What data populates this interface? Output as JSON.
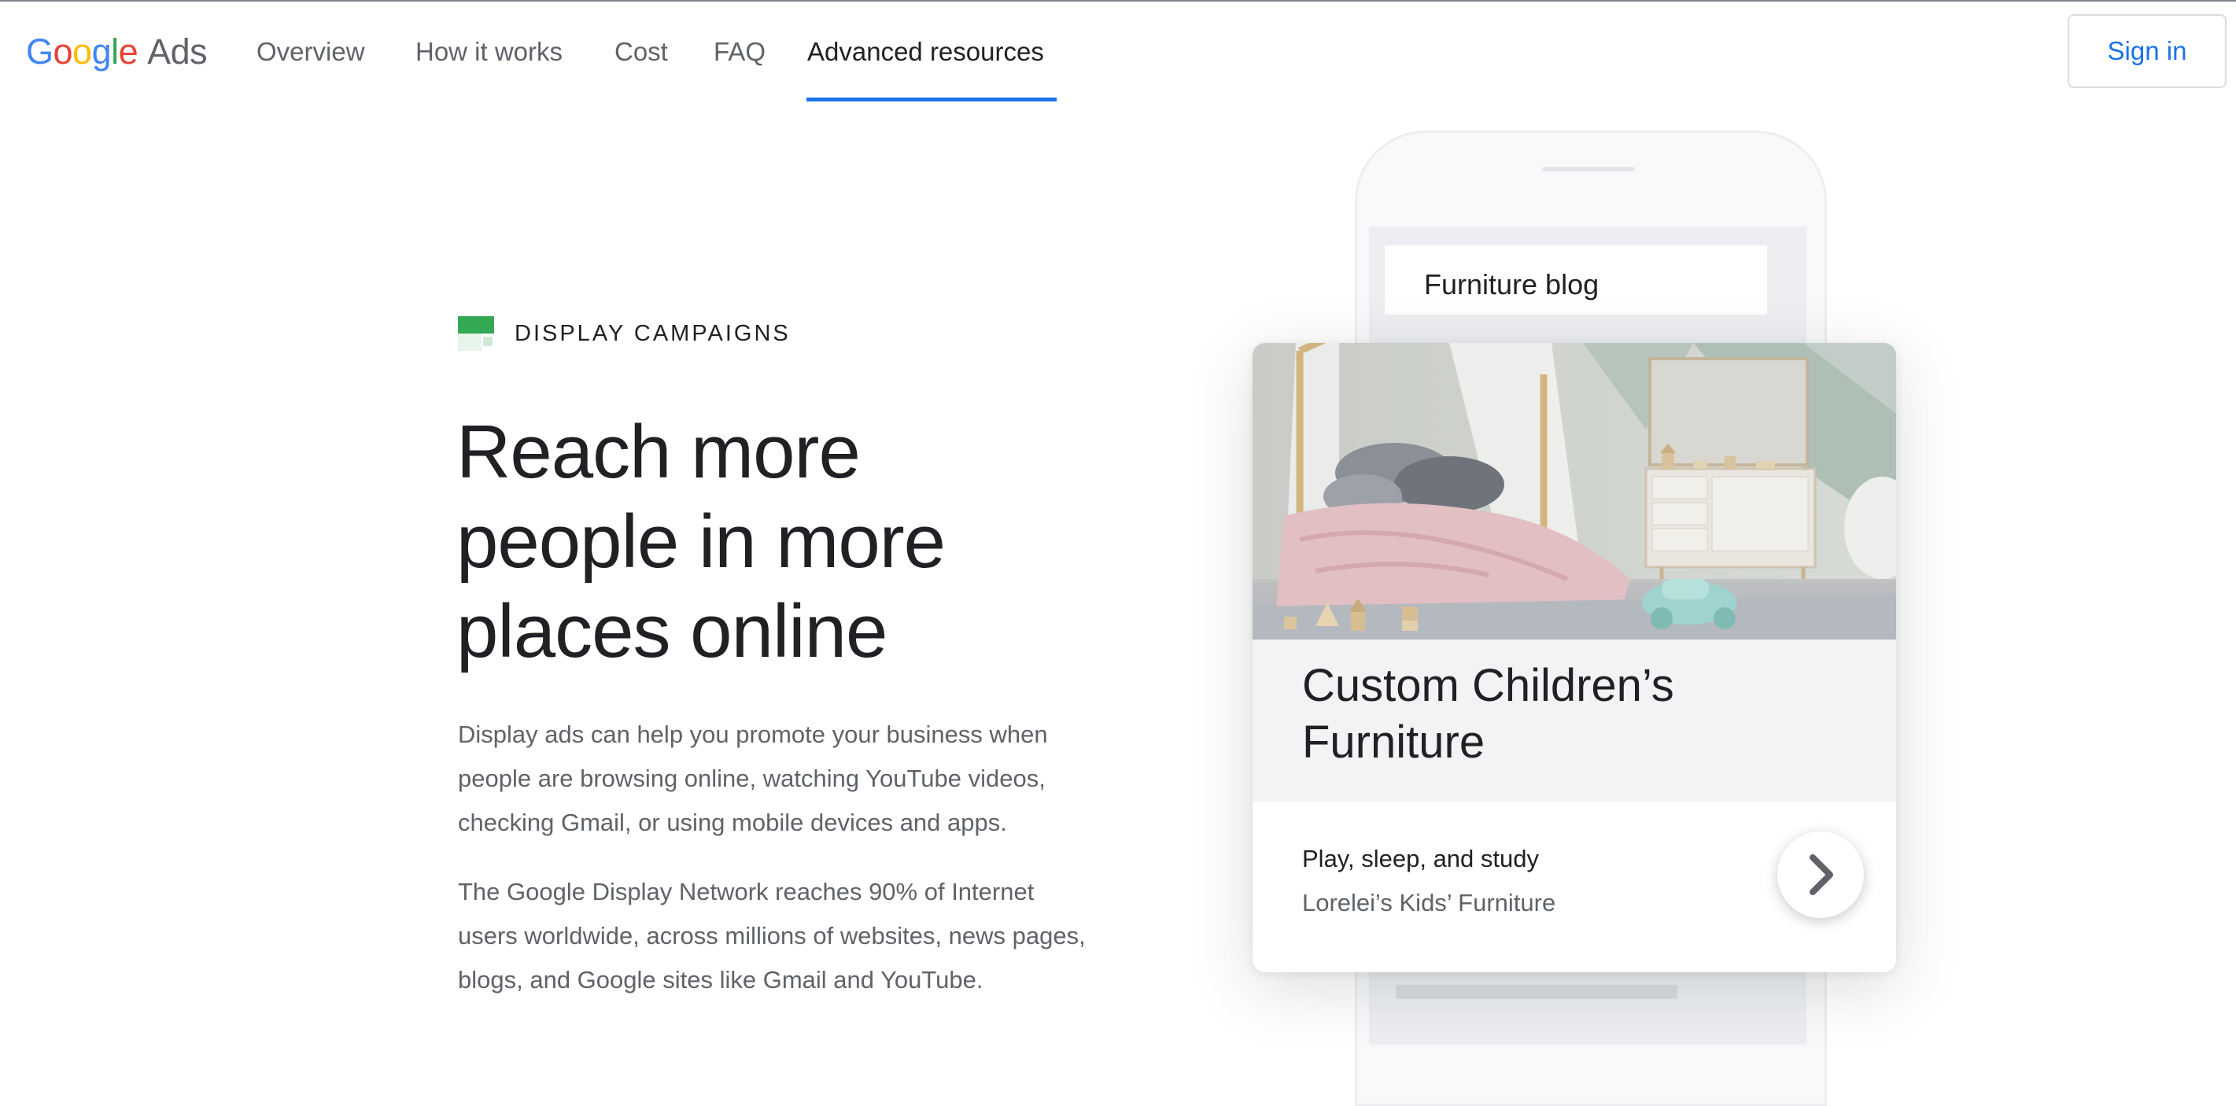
{
  "header": {
    "logo": {
      "g1": "G",
      "o1": "o",
      "o2": "o",
      "g2": "g",
      "l": "l",
      "e": "e",
      "product": "Ads"
    },
    "nav": [
      "Overview",
      "How it works",
      "Cost",
      "FAQ",
      "Advanced resources"
    ],
    "active_nav": "Advanced resources",
    "sign_in": "Sign in"
  },
  "hero": {
    "eyebrow": "DISPLAY CAMPAIGNS",
    "headline": [
      "Reach more",
      "people in more",
      "places online"
    ],
    "paragraph1": "Display ads can help you promote your business when people are browsing online, watching YouTube videos, checking Gmail, or using mobile devices and apps.",
    "paragraph2": "The Google Display Network reaches 90% of Internet users worldwide, across millions of websites, news pages, blogs, and Google sites like Gmail and YouTube."
  },
  "phone": {
    "blog_title": "Furniture blog",
    "ad": {
      "image": "children-bedroom-photo",
      "title": "Custom Children’s Furniture",
      "subtitle": "Play, sleep, and study",
      "advertiser": "Lorelei’s Kids’ Furniture",
      "action_icon": "chevron-right-icon"
    }
  },
  "colors": {
    "accent": "#1a73e8",
    "eyebrow_icon": "#34a853",
    "google_blue": "#4285F4",
    "google_red": "#EA4335",
    "google_yellow": "#FBBC05",
    "google_green": "#34A853"
  }
}
